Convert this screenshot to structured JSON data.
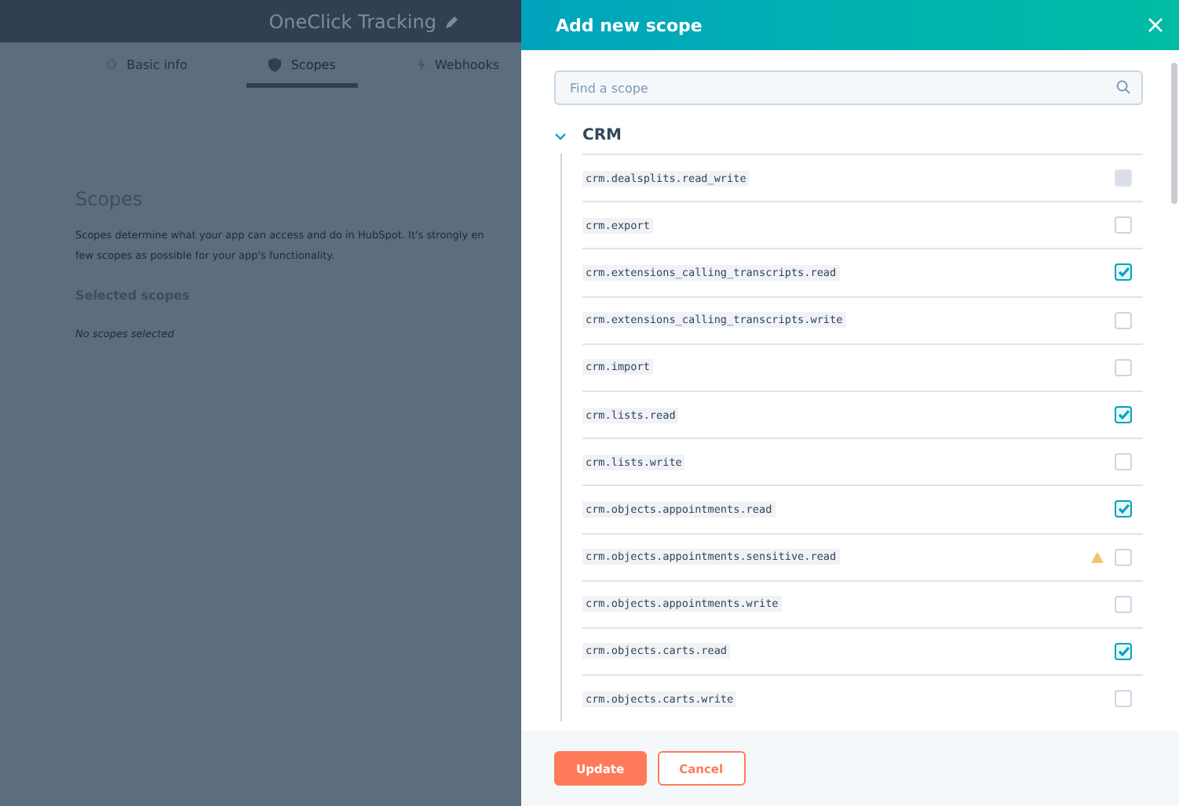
{
  "app": {
    "title": "OneClick Tracking",
    "tabs": [
      {
        "label": "Basic info",
        "selected": false
      },
      {
        "label": "Scopes",
        "selected": true
      },
      {
        "label": "Webhooks",
        "selected": false
      }
    ],
    "section_title": "Scopes",
    "description": "Scopes determine what your app can access and do in HubSpot. It's strongly en",
    "description_2": "few scopes as possible for your app's functionality.",
    "selected_heading": "Selected scopes",
    "empty_text": "No scopes selected"
  },
  "panel": {
    "title": "Add new scope",
    "search": {
      "placeholder": "Find a scope"
    },
    "group": {
      "name": "CRM",
      "expanded": true,
      "scopes": [
        {
          "name": "crm.dealsplits.read_write",
          "checked": false,
          "disabled": true,
          "warning": false
        },
        {
          "name": "crm.export",
          "checked": false,
          "disabled": false,
          "warning": false
        },
        {
          "name": "crm.extensions_calling_transcripts.read",
          "checked": true,
          "disabled": false,
          "warning": false
        },
        {
          "name": "crm.extensions_calling_transcripts.write",
          "checked": false,
          "disabled": false,
          "warning": false
        },
        {
          "name": "crm.import",
          "checked": false,
          "disabled": false,
          "warning": false
        },
        {
          "name": "crm.lists.read",
          "checked": true,
          "disabled": false,
          "warning": false
        },
        {
          "name": "crm.lists.write",
          "checked": false,
          "disabled": false,
          "warning": false
        },
        {
          "name": "crm.objects.appointments.read",
          "checked": true,
          "disabled": false,
          "warning": false
        },
        {
          "name": "crm.objects.appointments.sensitive.read",
          "checked": false,
          "disabled": false,
          "warning": true
        },
        {
          "name": "crm.objects.appointments.write",
          "checked": false,
          "disabled": false,
          "warning": false
        },
        {
          "name": "crm.objects.carts.read",
          "checked": true,
          "disabled": false,
          "warning": false
        },
        {
          "name": "crm.objects.carts.write",
          "checked": false,
          "disabled": false,
          "warning": false
        }
      ]
    },
    "buttons": [
      {
        "label": "Update",
        "kind": "primary"
      },
      {
        "label": "Cancel",
        "kind": "secondary"
      }
    ]
  }
}
